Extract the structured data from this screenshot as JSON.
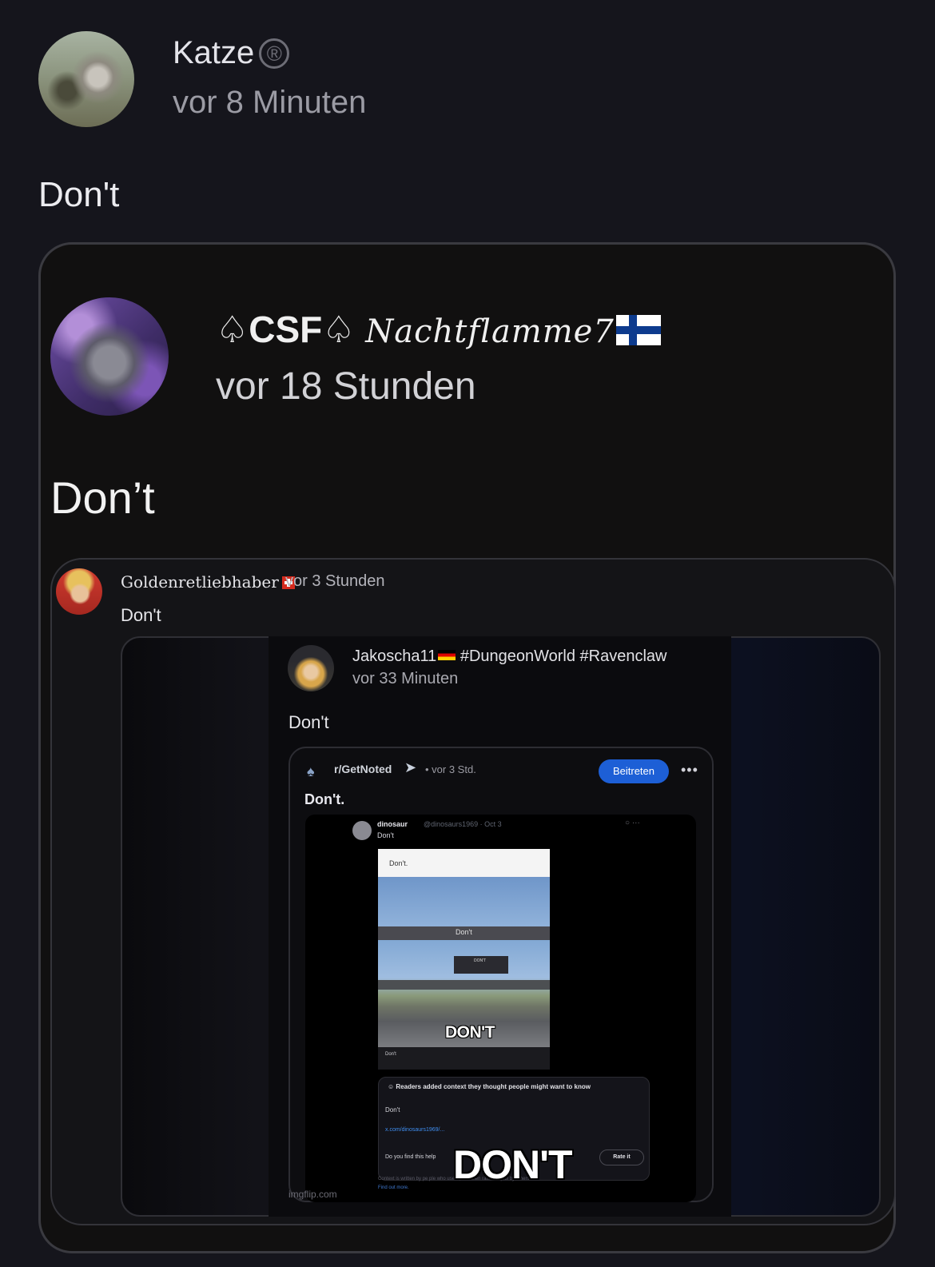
{
  "post": {
    "author": "Katze",
    "badge": "®",
    "time": "vor 8 Minuten",
    "text": "Don't"
  },
  "quote1": {
    "author_prefix": "♤CSF♤",
    "author_script": "Nachtflamme7",
    "time": "vor 18 Stunden",
    "text": "Don’t"
  },
  "quote2": {
    "author": "Goldenretliebhaber",
    "time": "vor 3 Stunden",
    "text": "Don't"
  },
  "quote3": {
    "author": "Jakoscha11",
    "tags": "#DungeonWorld #Ravenclaw",
    "time": "vor 33 Minuten",
    "text": "Don't"
  },
  "reddit": {
    "subreddit": "r/GetNoted",
    "time": "• vor 3 Std.",
    "join_label": "Beitreten",
    "more_label": "•••",
    "title": "Don't."
  },
  "tweet": {
    "name": "dinosaur",
    "handle": "@dinosaurs1969 · Oct 3",
    "text": "Don't",
    "meme_top": "Don't.",
    "meme_band": "Don't",
    "billboard": "DON'T",
    "meme_caption": "DON'T",
    "meme_bottom": "Don't"
  },
  "context_note": {
    "heading": "Readers added context they thought people might want to know",
    "text": "Don't",
    "link": "x.com/dinosaurs1969/...",
    "question": "Do you find this help",
    "rate_label": "Rate it",
    "footer": "Context is written by pe                         ple who use X, and then rated helpful by others.",
    "find_out": "Find out more."
  },
  "overlay": {
    "big_text": "DON'T",
    "watermark": "imgflip.com"
  }
}
